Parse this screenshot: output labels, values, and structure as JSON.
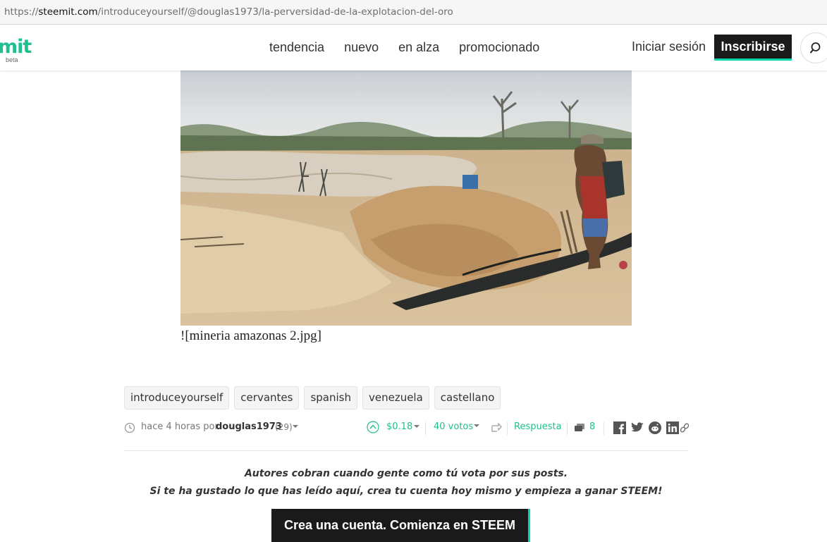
{
  "browser": {
    "url_scheme": "https://",
    "url_domain": "steemit.com",
    "url_path": "/introduceyourself/@douglas1973/la-perversidad-de-la-explotacion-del-oro"
  },
  "header": {
    "logo_text": "mit",
    "logo_badge": "beta",
    "nav": [
      "tendencia",
      "nuevo",
      "en alza",
      "promocionado"
    ],
    "login_label": "Iniciar sesión",
    "signup_label": "Inscribirse",
    "search_icon": "search-icon"
  },
  "post": {
    "image_alt": "mineria amazonas 2.jpg",
    "image_markdown": "![mineria amazonas 2.jpg]",
    "tags": [
      "introduceyourself",
      "cervantes",
      "spanish",
      "venezuela",
      "castellano"
    ],
    "meta": {
      "time_prefix": "hace 4 horas por",
      "author": "douglas1973",
      "reputation": "(29)",
      "payout": "$0.18",
      "votes": "40 votos",
      "reply_label": "Respuesta",
      "comments_count": "8"
    },
    "share_icons": [
      "facebook-icon",
      "twitter-icon",
      "reddit-icon",
      "linkedin-icon",
      "link-icon"
    ]
  },
  "cta": {
    "line1": "Autores cobran cuando gente como tú vota por sus posts.",
    "line2": "Si te ha gustado lo que has leído aquí, crea tu cuenta hoy mismo y empieza a ganar STEEM!",
    "button_label": "Crea una cuenta. Comienza en STEEM"
  },
  "colors": {
    "accent": "#06d6a9",
    "link": "#1fbf8f",
    "dark": "#1a1a1a"
  }
}
